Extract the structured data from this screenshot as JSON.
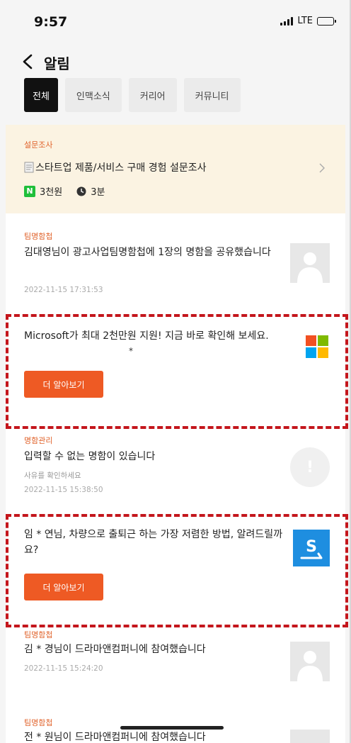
{
  "status": {
    "time": "9:57",
    "network": "LTE"
  },
  "header": {
    "title": "알림"
  },
  "tabs": [
    {
      "label": "전체",
      "active": true
    },
    {
      "label": "인맥소식",
      "active": false
    },
    {
      "label": "커리어",
      "active": false
    },
    {
      "label": "커뮤니티",
      "active": false
    }
  ],
  "survey": {
    "category": "설문조사",
    "title": "스타트업 제품/서비스 구매 경험 설문조사",
    "reward": "3천원",
    "duration": "3분",
    "reward_icon_letter": "N"
  },
  "notifications": [
    {
      "category": "팀명함첩",
      "message": "김대영님이 광고사업팀명함첩에 1장의 명함을 공유했습니다",
      "date": "2022-11-15 17:31:53"
    },
    {
      "ad": true,
      "message": "Microsoft가 최대 2천만원 지원! 지금 바로 확인해 보세요.",
      "button": "더 알아보기",
      "star": "*"
    },
    {
      "category": "명함관리",
      "message": "입력할 수 없는 명함이 있습니다",
      "sub": "사유를 확인하세요",
      "date": "2022-11-15 15:38:50"
    },
    {
      "ad": true,
      "message": "임 * 연님, 차량으로 출퇴근 하는 가장 저렴한 방법, 알려드릴까요?",
      "button": "더 알아보기"
    },
    {
      "category": "팀명함첩",
      "message": "김 * 경님이 드라마앤컴퍼니에 참여했습니다",
      "date": "2022-11-15 15:24:20"
    },
    {
      "category": "팀명함첩",
      "message": "전 * 원님이 드라마앤컴퍼니에 참여했습니다"
    }
  ],
  "colors": {
    "accent": "#ee5a24",
    "category": "#e0622a",
    "highlight": "#c4161c",
    "survey_bg": "#fbf3e2"
  },
  "icons": [
    "back-arrow-icon",
    "signal-icon",
    "battery-icon",
    "document-icon",
    "chevron-right-icon",
    "naver-pay-icon",
    "clock-icon",
    "avatar-placeholder-icon",
    "microsoft-logo-icon",
    "alert-icon",
    "socar-logo-icon"
  ]
}
